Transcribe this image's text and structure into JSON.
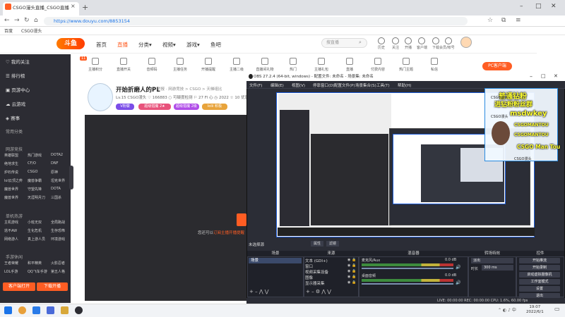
{
  "browser": {
    "tab_title": "CSGO漫头直播_CSGO直播",
    "url": "https://www.douyu.com/8853154",
    "bookmarks": [
      "百度",
      "CSGO漫头"
    ],
    "window_controls": [
      "–",
      "□",
      "✕"
    ]
  },
  "douyu": {
    "logo": "斗鱼",
    "nav": [
      {
        "label": "首页",
        "active": false
      },
      {
        "label": "直播",
        "active": true
      },
      {
        "label": "分类▾",
        "active": false
      },
      {
        "label": "视频▾",
        "active": false
      },
      {
        "label": "游戏▾",
        "active": false
      },
      {
        "label": "鱼吧",
        "active": false
      }
    ],
    "search_placeholder": "搜直播",
    "header_icons": [
      "历史",
      "关注",
      "开播",
      "客户端",
      "下载",
      "会员/帐号"
    ],
    "sidebar": {
      "items": [
        "我的关注",
        "排行榜",
        "页游中心",
        "云游戏",
        "赛事"
      ],
      "section1": "常用分类",
      "section2": "网游竞技",
      "grid2": [
        [
          "英雄联盟",
          "热门游戏",
          "DOTA2"
        ],
        [
          "绝地求生",
          "CF/O",
          "DNF"
        ],
        [
          "炉石传说",
          "CSGO",
          "原神"
        ],
        [
          "lol云顶之弈",
          "魔兽争霸",
          "坦克世界"
        ],
        [
          "魔兽世界",
          "守望先锋",
          "DOTA"
        ],
        [
          "魔兽世界",
          "天涯明月刀",
          "三国杀"
        ]
      ],
      "section3": "单机热游",
      "grid3": [
        [
          "主机游戏",
          "小班无双",
          "全局跑战"
        ],
        [
          "逃不AW",
          "生化危机",
          "生存恐怖"
        ],
        [
          "网络游人",
          "真上游人员",
          "环境游戏"
        ]
      ],
      "section4": "手游休闲",
      "grid4": [
        [
          "王者荣耀",
          "和平精英",
          "火影忍者"
        ],
        [
          "LOL手游",
          "QQ飞车手游",
          "第五人格"
        ]
      ],
      "btn1": "客户端打开",
      "btn2": "下载开播"
    },
    "categories": [
      "主播积分",
      "直播开关",
      "音频码",
      "主播任务",
      "开播提醒",
      "主播二级",
      "直播间礼物",
      "热门",
      "主播礼包",
      "直播",
      "付费内容",
      "热门主题",
      "私信"
    ],
    "cat_badge": "11",
    "pc_button": "PC客户端",
    "room": {
      "title": "开始折磨人的PL",
      "meta": "举报 · 网游竞技 > CSGO > 天梯组比",
      "stats": "Lv.15  CSGO漫头  ♡ 166883  ○ 可疑度检测  ⚐ 27 Fl 心  ◷ 2022  ☆ 10 优惠券",
      "badges": [
        "V粉徽",
        "超级猎魔 2★",
        "超级猎魔 2级",
        "lolii 积极"
      ],
      "follow_text_a": "您还可以",
      "follow_text_b": "订阅主播开播提醒"
    }
  },
  "obs": {
    "title": "OBS 27.2.4 (64-bit, windows) - 配置文件: 未命名 - 场景集: 未命名",
    "menu": [
      "文件(F)",
      "编辑(E)",
      "视图(V)",
      "停靠窗口(D)",
      "配置文件(P)",
      "场景集合(S)",
      "工具(T)",
      "帮助(H)"
    ],
    "scene_label": "未选择源",
    "props_btn": "属性",
    "filters_btn": "滤镜",
    "docks": [
      "场景",
      "来源",
      "混音器",
      "转场特效",
      "控件"
    ],
    "scene": "场景",
    "sources": [
      "文本 (GDI+)",
      "窗口",
      "视频采集设备",
      "图像",
      "显示器采集"
    ],
    "mixer": [
      {
        "name": "麦克风/Aux",
        "db": "0.0 dB"
      },
      {
        "name": "桌面音频",
        "db": "0.0 dB"
      }
    ],
    "transition": "淡出",
    "duration_label": "时长",
    "duration": "300 ms",
    "controls": [
      "开始推流",
      "开始录制",
      "启动虚拟摄像机",
      "工作室模式",
      "设置",
      "退出"
    ],
    "status": "LIVE: 00:00:00   REC: 00:00:00   CPU: 1.6%, 60.00 fps"
  },
  "overlay": {
    "line1": "普通钻粉",
    "line2": "进钻粉粉丝群",
    "line3": "msdwkey",
    "line4": "CSGOMANTOU",
    "line5": "CSGOMANTOU",
    "line6": "CSGO Man Tou",
    "small1": "CSGO漫头",
    "small2": "CSGO漫头",
    "small3": "CSGO漫头"
  },
  "taskbar": {
    "time": "19:07",
    "date": "2022/6/1"
  },
  "colors": {
    "brand": "#ff5d23",
    "obs_bg": "#2b2d36",
    "preview_border": "#1c5bd8"
  }
}
